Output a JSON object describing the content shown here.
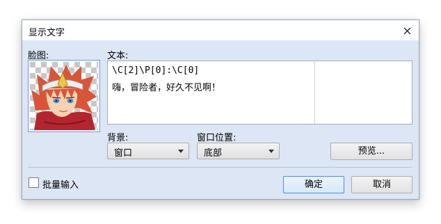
{
  "dialog": {
    "title": "显示文字",
    "close_icon": "close-icon"
  },
  "face": {
    "label": "脸图:"
  },
  "text": {
    "label": "文本:",
    "lines": [
      "\\C[2]\\P[0]:\\C[0]",
      "嗨，冒险者，好久不见啊！"
    ]
  },
  "background": {
    "label": "背景:",
    "value": "窗口"
  },
  "window_position": {
    "label": "窗口位置:",
    "value": "底部"
  },
  "buttons": {
    "preview": "预览...",
    "ok": "确定",
    "cancel": "取消"
  },
  "batch": {
    "label": "批量输入",
    "checked": false
  }
}
